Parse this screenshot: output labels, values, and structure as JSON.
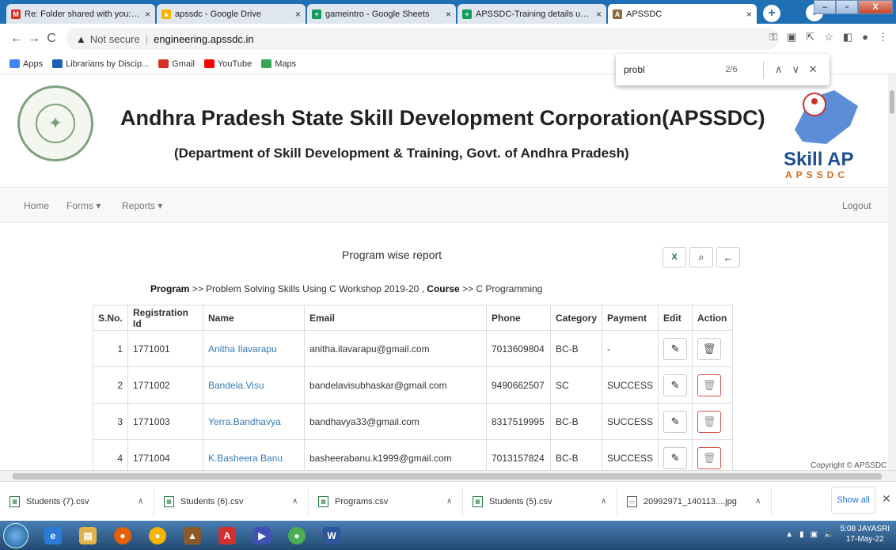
{
  "browser": {
    "tabs": [
      {
        "title": "Re: Folder shared with you: \"a",
        "color": "#d93025",
        "glyph": "M"
      },
      {
        "title": "apssdc - Google Drive",
        "color": "#f4b400",
        "glyph": "▲"
      },
      {
        "title": "gameintro - Google Sheets",
        "color": "#0f9d58",
        "glyph": "+"
      },
      {
        "title": "APSSDC-Training details upto",
        "color": "#0f9d58",
        "glyph": "+"
      },
      {
        "title": "APSSDC",
        "color": "#8a6d3b",
        "glyph": "A"
      }
    ],
    "url_notice": "Not secure",
    "url": "engineering.apssdc.in",
    "bookmarks": [
      {
        "label": "Apps",
        "color": "#4285f4"
      },
      {
        "label": "Librarians by Discip...",
        "color": "#1a5fb4"
      },
      {
        "label": "Gmail",
        "color": "#d93025"
      },
      {
        "label": "YouTube",
        "color": "#ff0000"
      },
      {
        "label": "Maps",
        "color": "#34a853"
      }
    ]
  },
  "find": {
    "query": "probl",
    "count": "2/6"
  },
  "header": {
    "title": "Andhra Pradesh State Skill Development Corporation(APSSDC)",
    "subtitle": "(Department of Skill Development & Training, Govt. of Andhra Pradesh)",
    "logo_text": "Skill AP",
    "logo_sub": "APSSDC"
  },
  "nav": {
    "home": "Home",
    "forms": "Forms ▾",
    "reports": "Reports ▾",
    "logout": "Logout"
  },
  "report": {
    "title": "Program wise report",
    "program_label": "Program",
    "program_value": ">> Problem Solving Skills Using C Workshop 2019-20 ,",
    "course_label": "Course",
    "course_value": ">> C Programming"
  },
  "table": {
    "headers": [
      "S.No.",
      "Registration Id",
      "Name",
      "Email",
      "Phone",
      "Category",
      "Payment",
      "Edit",
      "Action"
    ],
    "rows": [
      {
        "sn": "1",
        "reg": "1771001",
        "name": "Anitha Ilavarapu",
        "email": "anitha.ilavarapu@gmail.com",
        "phone": "7013609804",
        "cat": "BC-B",
        "pay": "-"
      },
      {
        "sn": "2",
        "reg": "1771002",
        "name": "Bandela.Visu",
        "email": "bandelavisubhaskar@gmail.com",
        "phone": "9490662507",
        "cat": "SC",
        "pay": "SUCCESS"
      },
      {
        "sn": "3",
        "reg": "1771003",
        "name": "Yerra.Bandhavya",
        "email": "bandhavya33@gmail.com",
        "phone": "8317519995",
        "cat": "BC-B",
        "pay": "SUCCESS"
      },
      {
        "sn": "4",
        "reg": "1771004",
        "name": "K.Basheera Banu",
        "email": "basheerabanu.k1999@gmail.com",
        "phone": "7013157824",
        "cat": "BC-B",
        "pay": "SUCCESS"
      }
    ]
  },
  "copyright": "Copyright © APSSDC",
  "downloads": {
    "items": [
      "Students (7).csv",
      "Students (6).csv",
      "Programs.csv",
      "Students (5).csv",
      "20992971_140113....jpg"
    ],
    "show_all": "Show all"
  },
  "taskbar": {
    "time": "5:08 JAYASRI",
    "date": "17-May-22"
  }
}
